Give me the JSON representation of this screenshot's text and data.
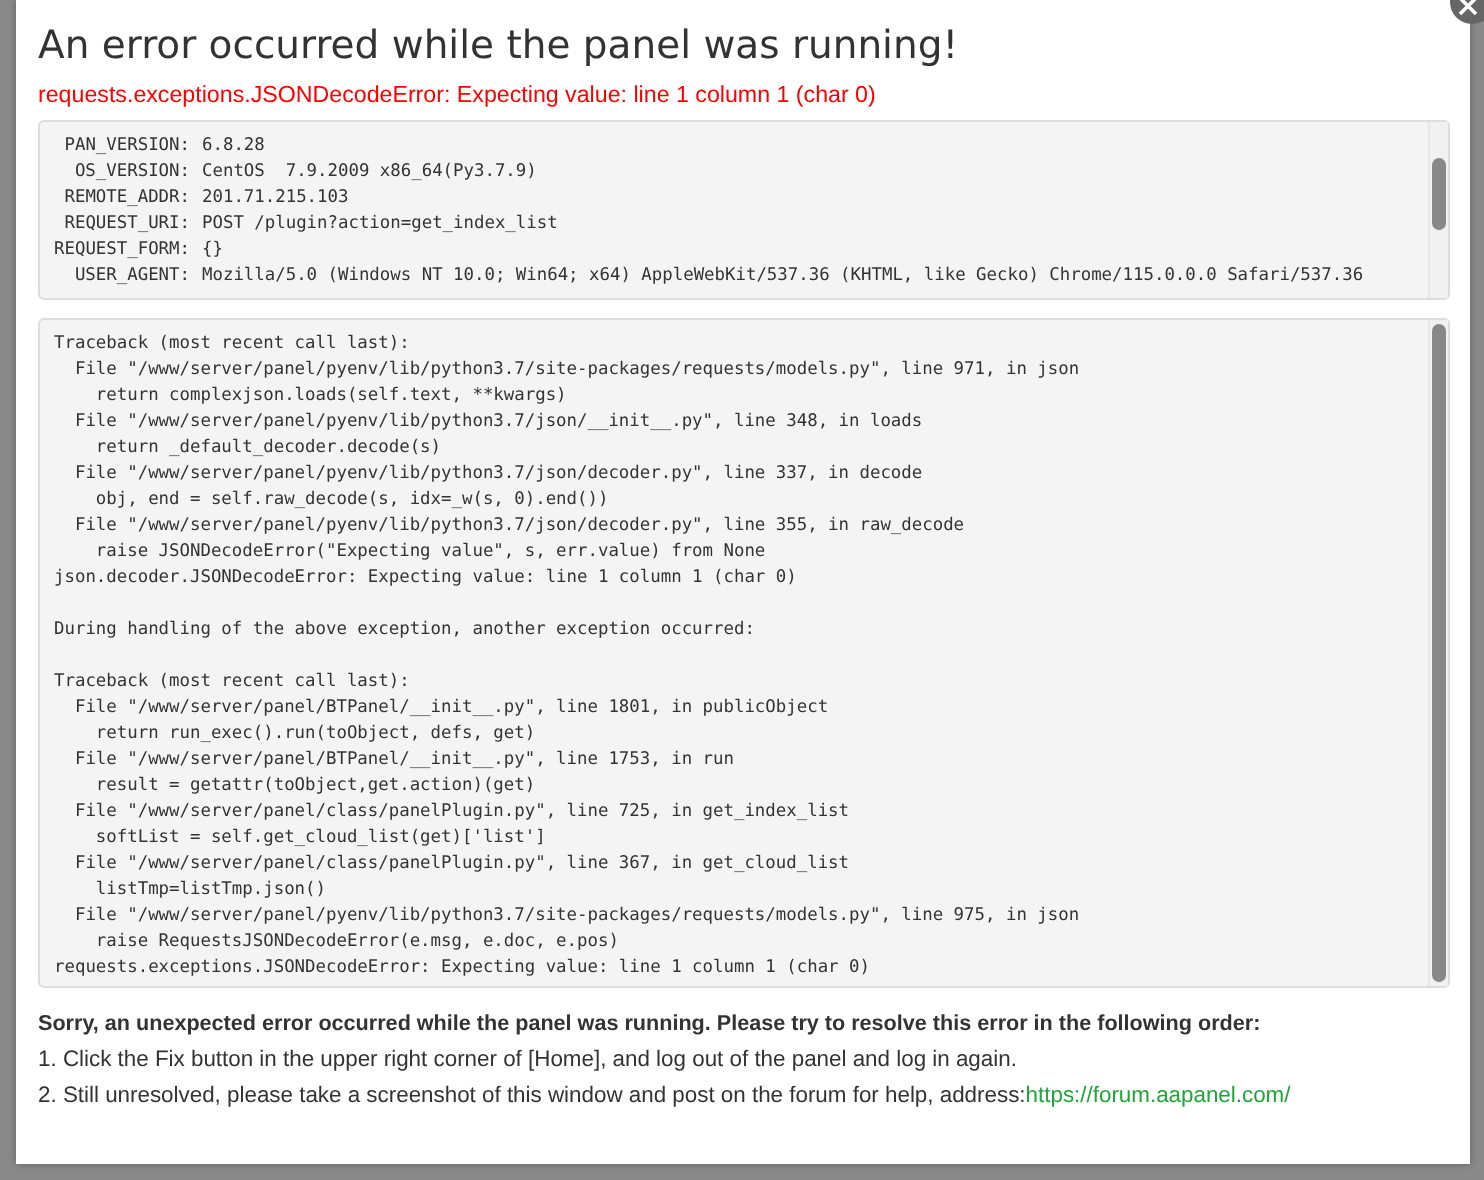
{
  "dialog": {
    "title": "An error occurred while the panel was running!",
    "error": "requests.exceptions.JSONDecodeError: Expecting value: line 1 column 1 (char 0)"
  },
  "request_info": [
    {
      "key": "PAN_VERSION:",
      "value": "6.8.28"
    },
    {
      "key": "OS_VERSION:",
      "value": "CentOS  7.9.2009 x86_64(Py3.7.9)"
    },
    {
      "key": "REMOTE_ADDR:",
      "value": "201.71.215.103"
    },
    {
      "key": "REQUEST_URI:",
      "value": "POST /plugin?action=get_index_list"
    },
    {
      "key": "REQUEST_FORM:",
      "value": "{}"
    },
    {
      "key": "USER_AGENT:",
      "value": "Mozilla/5.0 (Windows NT 10.0; Win64; x64) AppleWebKit/537.36 (KHTML, like Gecko) Chrome/115.0.0.0 Safari/537.36"
    }
  ],
  "traceback": [
    [
      "Traceback (most recent call last):",
      "  File \"/www/server/panel/pyenv/lib/python3.7/site-packages/requests/models.py\", line 971, in json",
      "    return complexjson.loads(self.text, **kwargs)",
      "  File \"/www/server/panel/pyenv/lib/python3.7/json/__init__.py\", line 348, in loads",
      "    return _default_decoder.decode(s)",
      "  File \"/www/server/panel/pyenv/lib/python3.7/json/decoder.py\", line 337, in decode",
      "    obj, end = self.raw_decode(s, idx=_w(s, 0).end())",
      "  File \"/www/server/panel/pyenv/lib/python3.7/json/decoder.py\", line 355, in raw_decode",
      "    raise JSONDecodeError(\"Expecting value\", s, err.value) from None",
      "json.decoder.JSONDecodeError: Expecting value: line 1 column 1 (char 0)"
    ],
    [
      "During handling of the above exception, another exception occurred:"
    ],
    [
      "Traceback (most recent call last):",
      "  File \"/www/server/panel/BTPanel/__init__.py\", line 1801, in publicObject",
      "    return run_exec().run(toObject, defs, get)",
      "  File \"/www/server/panel/BTPanel/__init__.py\", line 1753, in run",
      "    result = getattr(toObject,get.action)(get)",
      "  File \"/www/server/panel/class/panelPlugin.py\", line 725, in get_index_list",
      "    softList = self.get_cloud_list(get)['list']",
      "  File \"/www/server/panel/class/panelPlugin.py\", line 367, in get_cloud_list",
      "    listTmp=listTmp.json()",
      "  File \"/www/server/panel/pyenv/lib/python3.7/site-packages/requests/models.py\", line 975, in json",
      "    raise RequestsJSONDecodeError(e.msg, e.doc, e.pos)",
      "requests.exceptions.JSONDecodeError: Expecting value: line 1 column 1 (char 0)"
    ]
  ],
  "help": {
    "heading": "Sorry, an unexpected error occurred while the panel was running. Please try to resolve this error in the following order:",
    "steps": [
      {
        "text": "1. Click the Fix button in the upper right corner of [Home], and log out of the panel and log in again."
      },
      {
        "text": "2. Still unresolved, please take a screenshot of this window and post on the forum for help, address:",
        "link": "https://forum.aapanel.com/"
      }
    ]
  }
}
